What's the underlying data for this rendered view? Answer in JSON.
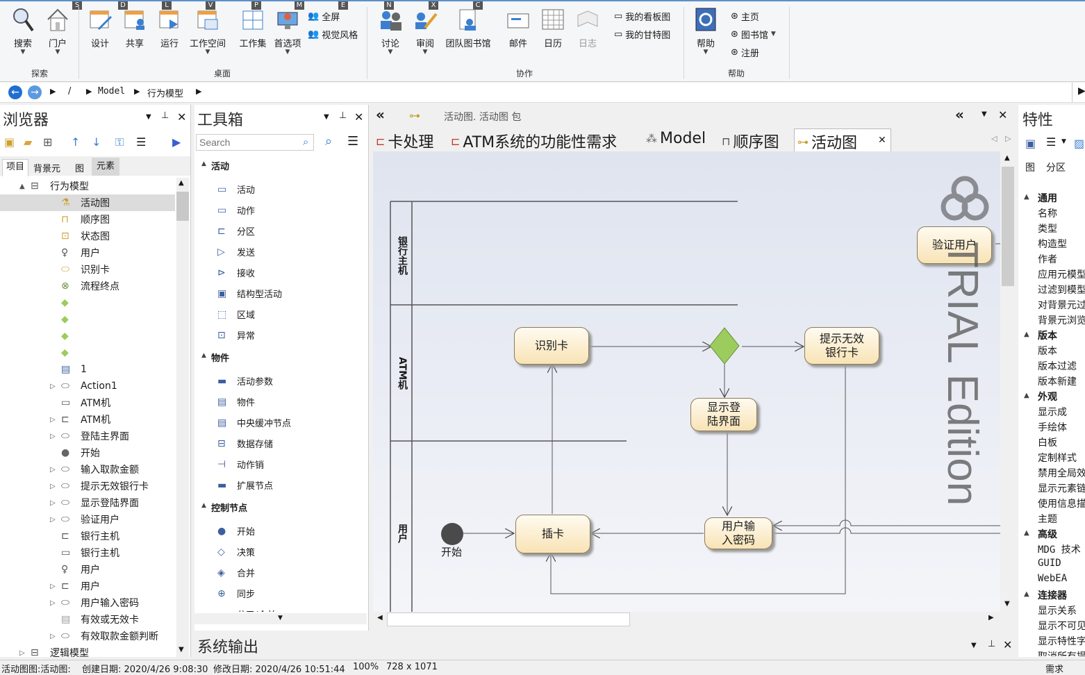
{
  "ribbon": {
    "keytips": [
      "S",
      "D",
      "L",
      "V",
      "P",
      "M",
      "E",
      "N",
      "X",
      "C"
    ],
    "buttons": {
      "search": "搜索",
      "portal": "门户",
      "design": "设计",
      "share": "共享",
      "run": "运行",
      "workspace": "工作空间",
      "workset": "工作集",
      "preferences": "首选项",
      "fullscreen": "全屏",
      "visual_style": "视觉风格",
      "discuss": "讨论",
      "review": "审阅",
      "team_library": "团队图书馆",
      "mail": "邮件",
      "calendar": "日历",
      "journal": "日志",
      "my_kanban": "我的看板图",
      "my_gantt": "我的甘特图",
      "help": "帮助",
      "home": "主页",
      "library": "图书馆",
      "register": "注册"
    },
    "groups": {
      "explore": "探索",
      "desktop": "桌面",
      "collaborate": "协作",
      "help": "帮助"
    }
  },
  "address": {
    "root": "/",
    "part1": "Model",
    "part2": "行为模型"
  },
  "browser": {
    "title": "浏览器",
    "tabs": [
      "项目",
      "背景元",
      "图",
      "元素"
    ],
    "tree": [
      {
        "label": "行为模型",
        "expander": "▲",
        "indent": 44
      },
      {
        "label": "活动图",
        "indent": 88,
        "selected": true
      },
      {
        "label": "顺序图",
        "indent": 88
      },
      {
        "label": "状态图",
        "indent": 88
      },
      {
        "label": "用户",
        "indent": 88
      },
      {
        "label": "识别卡",
        "indent": 88
      },
      {
        "label": "流程终点",
        "indent": 88
      },
      {
        "label": "",
        "indent": 88
      },
      {
        "label": "",
        "indent": 88
      },
      {
        "label": "",
        "indent": 88
      },
      {
        "label": "",
        "indent": 88
      },
      {
        "label": "1",
        "indent": 88
      },
      {
        "label": "Action1",
        "indent": 88,
        "expander": "▷"
      },
      {
        "label": "ATM机",
        "indent": 88
      },
      {
        "label": "ATM机",
        "indent": 88,
        "expander": "▷"
      },
      {
        "label": "登陆主界面",
        "indent": 88,
        "expander": "▷"
      },
      {
        "label": "开始",
        "indent": 88
      },
      {
        "label": "输入取款金额",
        "indent": 88,
        "expander": "▷"
      },
      {
        "label": "提示无效银行卡",
        "indent": 88,
        "expander": "▷"
      },
      {
        "label": "显示登陆界面",
        "indent": 88,
        "expander": "▷"
      },
      {
        "label": "验证用户",
        "indent": 88,
        "expander": "▷"
      },
      {
        "label": "银行主机",
        "indent": 88
      },
      {
        "label": "银行主机",
        "indent": 88
      },
      {
        "label": "用户",
        "indent": 88
      },
      {
        "label": "用户",
        "indent": 88,
        "expander": "▷"
      },
      {
        "label": "用户输入密码",
        "indent": 88,
        "expander": "▷"
      },
      {
        "label": "有效或无效卡",
        "indent": 88
      },
      {
        "label": "有效取款金额判断",
        "indent": 88,
        "expander": "▷"
      },
      {
        "label": "逻辑模型",
        "indent": 44,
        "expander": "▷"
      }
    ]
  },
  "toolbox": {
    "title": "工具箱",
    "search_placeholder": "Search",
    "sections": [
      {
        "name": "活动",
        "items": [
          "活动",
          "动作",
          "分区",
          "发送",
          "接收",
          "结构型活动",
          "区域",
          "异常"
        ]
      },
      {
        "name": "物件",
        "items": [
          "活动参数",
          "物件",
          "中央缓冲节点",
          "数据存储",
          "动作销",
          "扩展节点"
        ]
      },
      {
        "name": "控制节点",
        "items": [
          "开始",
          "决策",
          "合并",
          "同步",
          "分叉/合并"
        ]
      }
    ]
  },
  "diagram": {
    "breadcrumb": "活动图.  活动图 包",
    "tabs": [
      "卡处理",
      "ATM系统的功能性需求",
      "Model",
      "顺序图",
      "活动图"
    ],
    "active_tab": "活动图",
    "lanes": [
      "银行主机",
      "ATM机",
      "用户"
    ],
    "nodes": {
      "verify": "验证用户",
      "identify": "识别卡",
      "invalid": "提示无效\n银行卡",
      "show_login": "显示登\n陆界面",
      "insert": "插卡",
      "password": "用户输\n入密码",
      "start_label": "开始"
    },
    "watermark": "TRIAL Edition"
  },
  "properties": {
    "title": "特性",
    "tabs": [
      "图",
      "分区"
    ],
    "sections": [
      {
        "name": "通用",
        "rows": [
          "名称",
          "类型",
          "构造型",
          "作者",
          "应用元模型",
          "过滤到模型",
          "对背景元过",
          "背景元浏览"
        ]
      },
      {
        "name": "版本",
        "rows": [
          "版本",
          "版本过滤",
          "版本新建"
        ]
      },
      {
        "name": "外观",
        "rows": [
          "显示成",
          "手绘体",
          "白板",
          "定制样式",
          "禁用全局效",
          "显示元素链",
          "使用信息描",
          "主题"
        ]
      },
      {
        "name": "高级",
        "rows": [
          "MDG 技术",
          "GUID",
          "WebEA"
        ]
      },
      {
        "name": "连接器",
        "rows": [
          "显示关系",
          "显示不可见",
          "显示特性字",
          "取消所有提"
        ]
      }
    ]
  },
  "output": {
    "title": "系统输出"
  },
  "status": {
    "context": "活动图图:活动图:",
    "created": "创建日期: 2020/4/26 9:08:30",
    "modified": "修改日期: 2020/4/26 10:51:44",
    "zoom": "100%",
    "size": "728 x 1071",
    "right": "需求"
  },
  "colors": {
    "accent": "#3c7fd0",
    "node_fill": "#f8e3b5",
    "decision": "#9ccc5e"
  }
}
